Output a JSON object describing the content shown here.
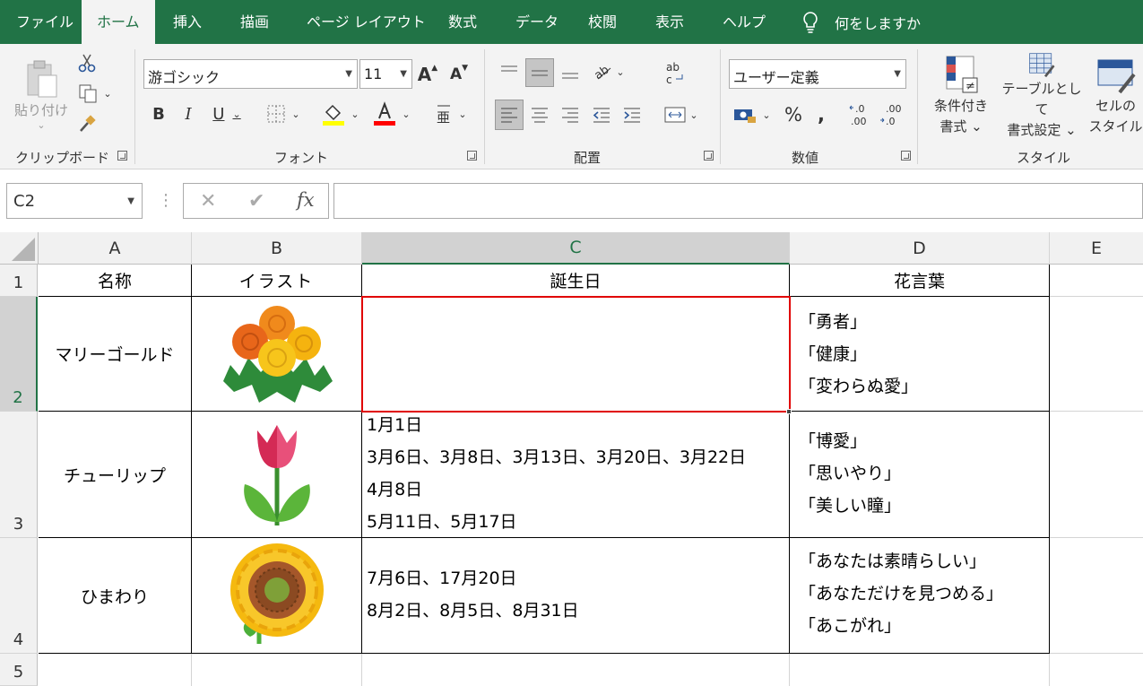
{
  "ribbon_tabs": [
    "ファイル",
    "ホーム",
    "挿入",
    "描画",
    "ページ レイアウト",
    "数式",
    "データ",
    "校閲",
    "表示",
    "ヘルプ"
  ],
  "active_tab": "ホーム",
  "tell_me": "何をしますか",
  "clipboard": {
    "paste_label": "貼り付け",
    "group_label": "クリップボード"
  },
  "font": {
    "name": "游ゴシック",
    "size": "11",
    "group_label": "フォント",
    "fill_color": "#ffff00",
    "font_color": "#ff0000"
  },
  "alignment": {
    "group_label": "配置"
  },
  "number": {
    "format": "ユーザー定義",
    "group_label": "数値"
  },
  "styles": {
    "conditional": [
      "条件付き",
      "書式 ⌄"
    ],
    "table": [
      "テーブルとして",
      "書式設定 ⌄"
    ],
    "cell": [
      "セルの",
      "スタイル"
    ],
    "group_label": "スタイル"
  },
  "formula_bar": {
    "name_box": "C2",
    "fx": "fx",
    "content": ""
  },
  "columns": [
    "A",
    "B",
    "C",
    "D",
    "E"
  ],
  "selected_column": "C",
  "rows": [
    "1",
    "2",
    "3",
    "4",
    "5"
  ],
  "selected_cell": "C2",
  "header_row": {
    "a": "名称",
    "b": "イラスト",
    "c": "誕生日",
    "d": "花言葉"
  },
  "flowers": [
    {
      "name": "マリーゴールド",
      "illustration": "marigold-illustration",
      "birthdays": [],
      "meanings": [
        "「勇者」",
        "「健康」",
        "「変わらぬ愛」"
      ]
    },
    {
      "name": "チューリップ",
      "illustration": "tulip-illustration",
      "birthdays": [
        "1月1日",
        "3月6日、3月8日、3月13日、3月20日、3月22日",
        "4月8日",
        "5月11日、5月17日"
      ],
      "meanings": [
        "「博愛」",
        "「思いやり」",
        "「美しい瞳」"
      ]
    },
    {
      "name": "ひまわり",
      "illustration": "sunflower-illustration",
      "birthdays": [
        "7月6日、17月20日",
        "8月2日、8月5日、8月31日"
      ],
      "meanings": [
        "「あなたは素晴らしい」",
        "「あなただけを見つめる」",
        "「あこがれ」"
      ]
    }
  ],
  "colors": {
    "excel_green": "#217346",
    "selection_border": "#e00000"
  }
}
